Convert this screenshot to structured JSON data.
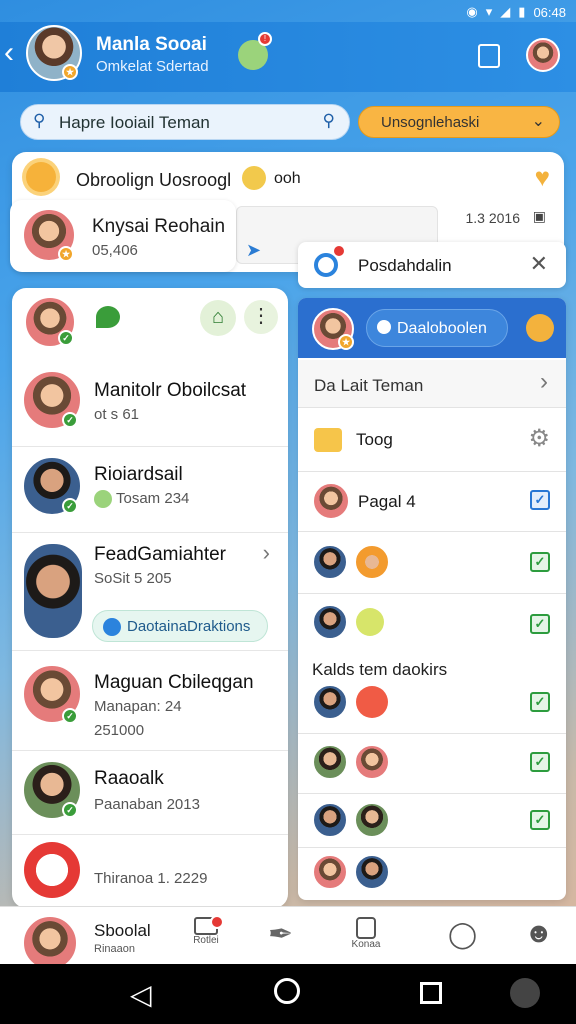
{
  "status": {
    "time": "06:48"
  },
  "header": {
    "title": "Manla Sooai",
    "subtitle": "Omkelat Sdertad",
    "notif_count": "!"
  },
  "search": {
    "placeholder": "Hapre Iooiail Teman",
    "filter_label": "Unsognlehaski"
  },
  "chat_card": {
    "title": "Obroolign Uosroogl",
    "extra": "ooh",
    "contact_name": "Knysai Reohain",
    "contact_sub": "05,406",
    "time": "1.3 2016"
  },
  "popup": {
    "title": "Posdahdalin"
  },
  "left_list": [
    {
      "name": "Manitolr Oboilcsat",
      "sub": "ot  s 61"
    },
    {
      "name": "Rioiardsail",
      "sub": "Tosam 234"
    },
    {
      "name": "FeadGamiahter",
      "sub": "SoSit 5 205",
      "tag": "DaotainaDraktions"
    },
    {
      "name": "Maguan Cbileqgan",
      "sub": "Manapan: 24",
      "sub2": "251000"
    },
    {
      "name": "Raaoalk",
      "sub": "Paanaban 2013"
    },
    {
      "name": "",
      "sub": "Thiranoa 1. 2229"
    }
  ],
  "right_panel": {
    "button": "Daaloboolen",
    "see_all": "Da Lait Teman",
    "section": "Kalds tem daokirs",
    "rows": [
      {
        "label": "Toog",
        "check": ""
      },
      {
        "label": "Pagal 4",
        "check": "blue"
      },
      {
        "label": "",
        "check": "green"
      },
      {
        "label": "",
        "check": "green"
      },
      {
        "label": "",
        "check": "green"
      },
      {
        "label": "",
        "check": "green"
      },
      {
        "label": "",
        "check": "green"
      }
    ]
  },
  "nav": {
    "profile_name": "Sboolal",
    "profile_sub": "Rinaaon",
    "items": [
      "Rotlei",
      "",
      "Konaa",
      "",
      ""
    ]
  }
}
